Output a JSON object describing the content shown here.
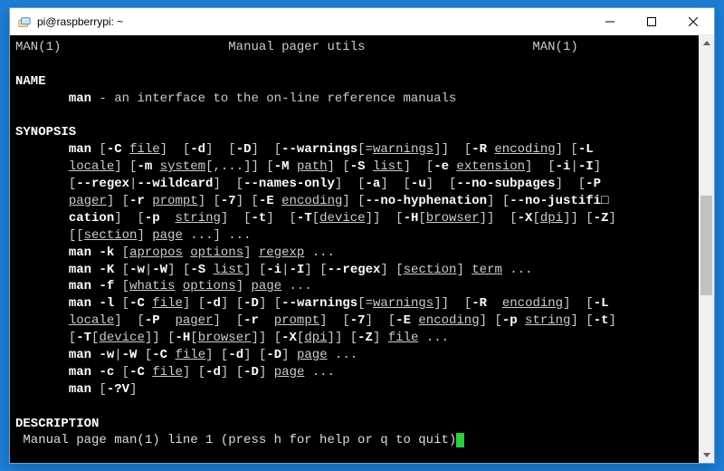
{
  "window": {
    "title": "pi@raspberrypi: ~"
  },
  "header": {
    "left": "MAN(1)",
    "center": "Manual pager utils",
    "right": "MAN(1)"
  },
  "sections": {
    "name_heading": "NAME",
    "name_body_cmd": "man",
    "name_body_rest": " - an interface to the on-line reference manuals",
    "synopsis_heading": "SYNOPSIS",
    "description_heading": "DESCRIPTION"
  },
  "synopsis_lines": {
    "l1": {
      "cmd": "man",
      "t2": " [",
      "o1": "-C",
      "t3": " ",
      "u1": "file",
      "t4": "]  [",
      "o2": "-d",
      "t5": "]  [",
      "o3": "-D",
      "t6": "]  [",
      "o4": "--warnings",
      "t7": "[=",
      "u2": "warnings",
      "t8": "]]  [",
      "o5": "-R",
      "t9": " ",
      "u3": "encoding",
      "t10": "] [",
      "o6": "-L",
      "end": ""
    },
    "l2": {
      "u1": "locale",
      "t1": "] [",
      "o1": "-m",
      "t2": " ",
      "u2": "system",
      "t3": "[,...]] [",
      "o2": "-M",
      "t4": " ",
      "u3": "path",
      "t5": "] [",
      "o3": "-S",
      "t6": " ",
      "u4": "list",
      "t7": "]  [",
      "o4": "-e",
      "t8": " ",
      "u5": "extension",
      "t9": "]  [",
      "o5": "-i",
      "t10": "|",
      "o6": "-I",
      "t11": "]"
    },
    "l3": {
      "t1": "[",
      "o1": "--regex",
      "t2": "|",
      "o2": "--wildcard",
      "t3": "]  [",
      "o3": "--names-only",
      "t4": "]  [",
      "o4": "-a",
      "t5": "]  [",
      "o5": "-u",
      "t6": "]  [",
      "o6": "--no-subpages",
      "t7": "]  [",
      "o7": "-P",
      "end": ""
    },
    "l4": {
      "u1": "pager",
      "t1": "] [",
      "o1": "-r",
      "t2": " ",
      "u2": "prompt",
      "t3": "] [",
      "o2": "-7",
      "t4": "] [",
      "o3": "-E",
      "t5": " ",
      "u3": "encoding",
      "t6": "] [",
      "o4": "--no-hyphenation",
      "t7": "] [",
      "o5": "--no-justifi□",
      "end": ""
    },
    "l5": {
      "o1": "cation",
      "t1": "]  [",
      "o2": "-p",
      "t2": "  ",
      "u1": "string",
      "t3": "]  [",
      "o3": "-t",
      "t4": "]  [",
      "o4": "-T",
      "t5": "[",
      "u2": "device",
      "t6": "]]  [",
      "o5": "-H",
      "t7": "[",
      "u3": "browser",
      "t8": "]]  [",
      "o6": "-X",
      "t9": "[",
      "u4": "dpi",
      "t10": "]] [",
      "o7": "-Z",
      "t11": "]"
    },
    "l6": {
      "t1": "[[",
      "u1": "section",
      "t2": "] ",
      "u2": "page",
      "t3": " ...] ..."
    },
    "l7": {
      "cmd": "man",
      "t1": " ",
      "o1": "-k",
      "t2": " [",
      "u1": "apropos",
      "t3": " ",
      "u2": "options",
      "t4": "] ",
      "u3": "regexp",
      "t5": " ..."
    },
    "l8": {
      "cmd": "man",
      "t1": " ",
      "o1": "-K",
      "t2": " [",
      "o2": "-w",
      "t3": "|",
      "o3": "-W",
      "t4": "] [",
      "o4": "-S",
      "t5": " ",
      "u1": "list",
      "t6": "] [",
      "o5": "-i",
      "t7": "|",
      "o6": "-I",
      "t8": "] [",
      "o7": "--regex",
      "t9": "] [",
      "u2": "section",
      "t10": "] ",
      "u3": "term",
      "t11": " ..."
    },
    "l9": {
      "cmd": "man",
      "t1": " ",
      "o1": "-f",
      "t2": " [",
      "u1": "whatis",
      "t3": " ",
      "u2": "options",
      "t4": "] ",
      "u3": "page",
      "t5": " ..."
    },
    "l10": {
      "cmd": "man",
      "t1": " ",
      "o1": "-l",
      "t2": " [",
      "o2": "-C",
      "t3": " ",
      "u1": "file",
      "t4": "] [",
      "o3": "-d",
      "t5": "] [",
      "o4": "-D",
      "t6": "] [",
      "o5": "--warnings",
      "t7": "[=",
      "u2": "warnings",
      "t8": "]]  [",
      "o6": "-R",
      "t9": "  ",
      "u3": "encoding",
      "t10": "]  [",
      "o7": "-L",
      "end": ""
    },
    "l11": {
      "u1": "locale",
      "t1": "]  [",
      "o1": "-P",
      "t2": "  ",
      "u2": "pager",
      "t3": "]  [",
      "o2": "-r",
      "t4": "  ",
      "u3": "prompt",
      "t5": "]  [",
      "o3": "-7",
      "t6": "]  [",
      "o4": "-E",
      "t7": " ",
      "u4": "encoding",
      "t8": "] [",
      "o5": "-p",
      "t9": " ",
      "u5": "string",
      "t10": "] [",
      "o6": "-t",
      "t11": "]"
    },
    "l12": {
      "t1": "[",
      "o1": "-T",
      "t2": "[",
      "u1": "device",
      "t3": "]] [",
      "o2": "-H",
      "t4": "[",
      "u2": "browser",
      "t5": "]] [",
      "o3": "-X",
      "t6": "[",
      "u3": "dpi",
      "t7": "]] [",
      "o4": "-Z",
      "t8": "] ",
      "u4": "file",
      "t9": " ..."
    },
    "l13": {
      "cmd": "man",
      "t1": " ",
      "o1": "-w",
      "t2": "|",
      "o2": "-W",
      "t3": " [",
      "o3": "-C",
      "t4": " ",
      "u1": "file",
      "t5": "] [",
      "o4": "-d",
      "t6": "] [",
      "o5": "-D",
      "t7": "] ",
      "u2": "page",
      "t8": " ..."
    },
    "l14": {
      "cmd": "man",
      "t1": " ",
      "o1": "-c",
      "t2": " [",
      "o2": "-C",
      "t3": " ",
      "u1": "file",
      "t4": "] [",
      "o3": "-d",
      "t5": "] [",
      "o4": "-D",
      "t6": "] ",
      "u2": "page",
      "t7": " ..."
    },
    "l15": {
      "cmd": "man",
      "t1": " [",
      "o1": "-?V",
      "t2": "]"
    }
  },
  "status": {
    "text": " Manual page man(1) line 1 (press h for help or q to quit)",
    "cursor": " "
  }
}
